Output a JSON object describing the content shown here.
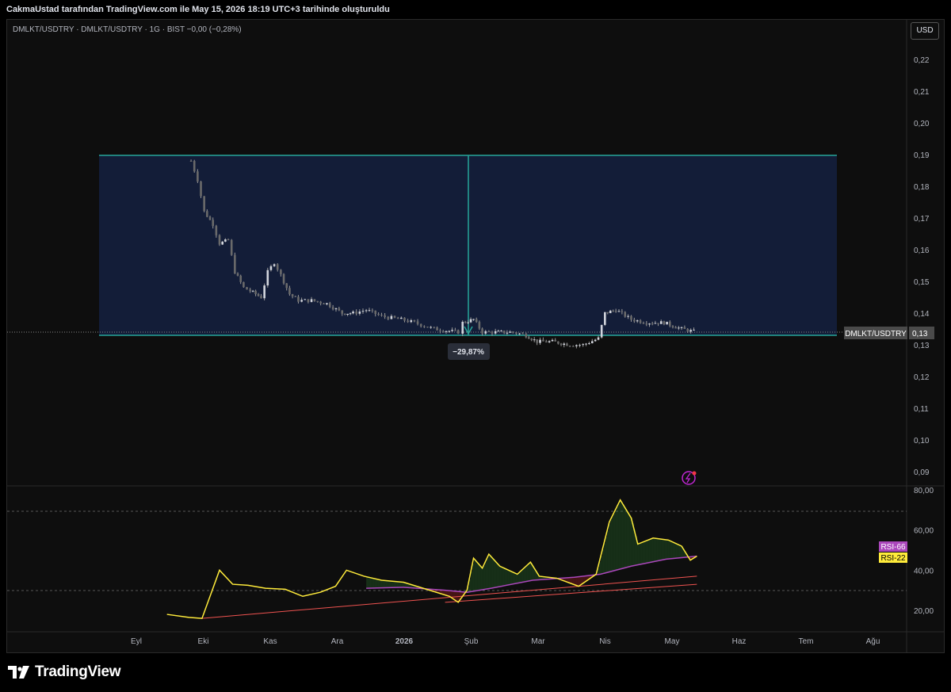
{
  "header": {
    "caption": "CakmaUstad tarafından TradingView.com ile May 15, 2026 18:19 UTC+3 tarihinde oluşturuldu"
  },
  "symbol_line": "DMLKT/USDTRY · DMLKT/USDTRY · 1G · BIST  −0,00 (−0,28%)",
  "currency_button": "USD",
  "price_tag": {
    "symbol": "DMLKT/USDTRY",
    "value": "0,13"
  },
  "measure_label": "−29,87%",
  "brand": "TradingView",
  "chart_data": [
    {
      "type": "candlestick",
      "title": "DMLKT/USDTRY · DMLKT/USDTRY · 1G · BIST",
      "x_tick_labels": [
        "Eyl",
        "Eki",
        "Kas",
        "Ara",
        "2026",
        "Şub",
        "Mar",
        "Nis",
        "May",
        "Haz",
        "Tem",
        "Ağu"
      ],
      "y_tick_labels": [
        "0,22",
        "0,21",
        "0,20",
        "0,19",
        "0,18",
        "0,17",
        "0,16",
        "0,15",
        "0,14",
        "0,13",
        "0,12",
        "0,11",
        "0,10",
        "0,09"
      ],
      "ylim": [
        0.085,
        0.225
      ],
      "price_path": [
        [
          "2025-09-26",
          0.188
        ],
        [
          "2025-09-29",
          0.182
        ],
        [
          "2025-10-02",
          0.172
        ],
        [
          "2025-10-06",
          0.168
        ],
        [
          "2025-10-09",
          0.162
        ],
        [
          "2025-10-13",
          0.163
        ],
        [
          "2025-10-16",
          0.153
        ],
        [
          "2025-10-20",
          0.148
        ],
        [
          "2025-10-23",
          0.147
        ],
        [
          "2025-10-28",
          0.145
        ],
        [
          "2025-10-31",
          0.153
        ],
        [
          "2025-11-03",
          0.156
        ],
        [
          "2025-11-06",
          0.152
        ],
        [
          "2025-11-10",
          0.146
        ],
        [
          "2025-11-14",
          0.144
        ],
        [
          "2025-11-20",
          0.144
        ],
        [
          "2025-11-27",
          0.143
        ],
        [
          "2025-12-04",
          0.14
        ],
        [
          "2025-12-09",
          0.14
        ],
        [
          "2025-12-15",
          0.141
        ],
        [
          "2025-12-22",
          0.139
        ],
        [
          "2025-12-31",
          0.138
        ],
        [
          "2026-01-06",
          0.137
        ],
        [
          "2026-01-15",
          0.135
        ],
        [
          "2026-01-26",
          0.134
        ],
        [
          "2026-01-28",
          0.137
        ],
        [
          "2026-02-02",
          0.138
        ],
        [
          "2026-02-06",
          0.134
        ],
        [
          "2026-02-12",
          0.134
        ],
        [
          "2026-02-20",
          0.134
        ],
        [
          "2026-02-26",
          0.133
        ],
        [
          "2026-03-03",
          0.131
        ],
        [
          "2026-03-10",
          0.131
        ],
        [
          "2026-03-18",
          0.13
        ],
        [
          "2026-03-24",
          0.13
        ],
        [
          "2026-03-31",
          0.132
        ],
        [
          "2026-04-03",
          0.14
        ],
        [
          "2026-04-08",
          0.141
        ],
        [
          "2026-04-15",
          0.138
        ],
        [
          "2026-04-22",
          0.137
        ],
        [
          "2026-04-30",
          0.137
        ],
        [
          "2026-05-08",
          0.135
        ],
        [
          "2026-05-15",
          0.134
        ]
      ],
      "measurement": {
        "top": 0.19,
        "bottom": 0.133,
        "change": "−29,87%"
      },
      "last_price": "0,13"
    },
    {
      "type": "line",
      "title": "RSI",
      "y_tick_labels": [
        "80,00",
        "60,00",
        "40,00",
        "20,00"
      ],
      "ylim": [
        12,
        80
      ],
      "series": [
        {
          "name": "RSI-22",
          "color": "#ffeb3b",
          "points": [
            [
              "2025-09-15",
              18
            ],
            [
              "2025-09-25",
              16.5
            ],
            [
              "2025-10-01",
              16
            ],
            [
              "2025-10-05",
              28
            ],
            [
              "2025-10-09",
              40
            ],
            [
              "2025-10-15",
              33
            ],
            [
              "2025-10-22",
              32.5
            ],
            [
              "2025-10-30",
              31
            ],
            [
              "2025-11-08",
              30.5
            ],
            [
              "2025-11-16",
              27
            ],
            [
              "2025-11-24",
              29
            ],
            [
              "2025-12-01",
              32
            ],
            [
              "2025-12-06",
              40
            ],
            [
              "2025-12-14",
              37
            ],
            [
              "2025-12-22",
              35
            ],
            [
              "2026-01-01",
              34
            ],
            [
              "2026-01-10",
              31
            ],
            [
              "2026-01-22",
              27
            ],
            [
              "2026-01-26",
              24
            ],
            [
              "2026-01-30",
              30
            ],
            [
              "2026-02-02",
              46
            ],
            [
              "2026-02-06",
              41
            ],
            [
              "2026-02-09",
              48
            ],
            [
              "2026-02-14",
              42
            ],
            [
              "2026-02-22",
              38
            ],
            [
              "2026-02-28",
              44
            ],
            [
              "2026-03-04",
              37
            ],
            [
              "2026-03-12",
              36
            ],
            [
              "2026-03-22",
              32
            ],
            [
              "2026-03-30",
              38
            ],
            [
              "2026-04-05",
              64
            ],
            [
              "2026-04-10",
              75
            ],
            [
              "2026-04-15",
              66
            ],
            [
              "2026-04-18",
              53
            ],
            [
              "2026-04-25",
              56
            ],
            [
              "2026-05-02",
              55
            ],
            [
              "2026-05-08",
              52
            ],
            [
              "2026-05-12",
              45
            ],
            [
              "2026-05-15",
              47
            ]
          ]
        },
        {
          "name": "RSI-66",
          "color": "#ab47bc",
          "points": [
            [
              "2025-12-15",
              31
            ],
            [
              "2026-01-01",
              31.5
            ],
            [
              "2026-01-20",
              30
            ],
            [
              "2026-01-30",
              29
            ],
            [
              "2026-02-10",
              31
            ],
            [
              "2026-03-01",
              35
            ],
            [
              "2026-03-20",
              36.5
            ],
            [
              "2026-04-01",
              38
            ],
            [
              "2026-04-15",
              42
            ],
            [
              "2026-05-01",
              45.5
            ],
            [
              "2026-05-15",
              47
            ]
          ]
        }
      ],
      "trendlines": [
        {
          "from": [
            "2025-10-01",
            16
          ],
          "to": [
            "2026-05-15",
            37
          ],
          "color": "#ef5350"
        },
        {
          "from": [
            "2026-01-20",
            24
          ],
          "to": [
            "2026-05-15",
            33
          ],
          "color": "#ef5350"
        }
      ],
      "reference_levels": [
        70,
        30
      ],
      "legend": [
        "RSI-66",
        "RSI-22"
      ]
    }
  ]
}
